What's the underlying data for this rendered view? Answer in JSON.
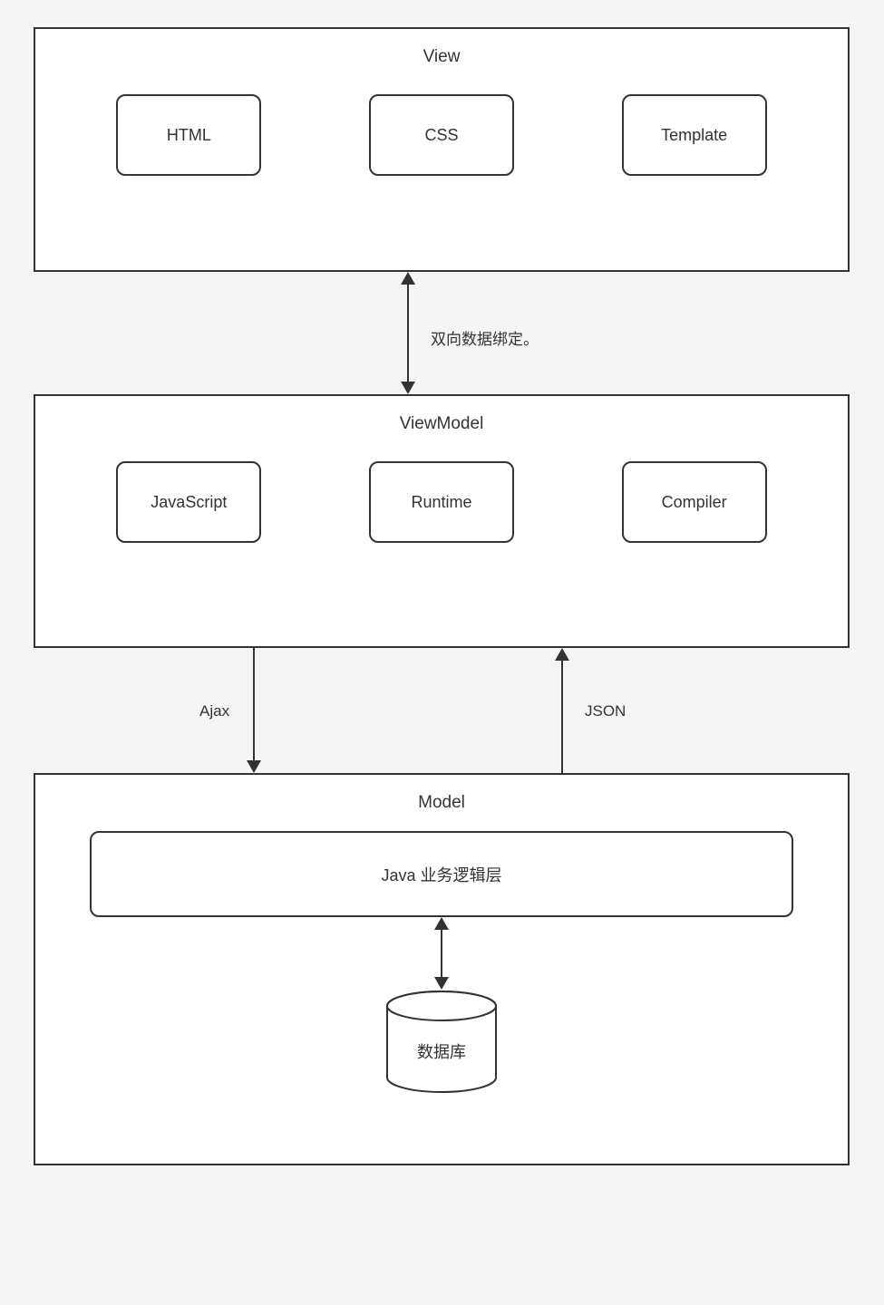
{
  "layers": {
    "view": {
      "title": "View",
      "boxes": [
        "HTML",
        "CSS",
        "Template"
      ]
    },
    "viewmodel": {
      "title": "ViewModel",
      "boxes": [
        "JavaScript",
        "Runtime",
        "Compiler"
      ]
    },
    "model": {
      "title": "Model",
      "logic_box": "Java 业务逻辑层",
      "database": "数据库"
    }
  },
  "connectors": {
    "view_viewmodel": "双向数据绑定。",
    "ajax": "Ajax",
    "json": "JSON"
  }
}
